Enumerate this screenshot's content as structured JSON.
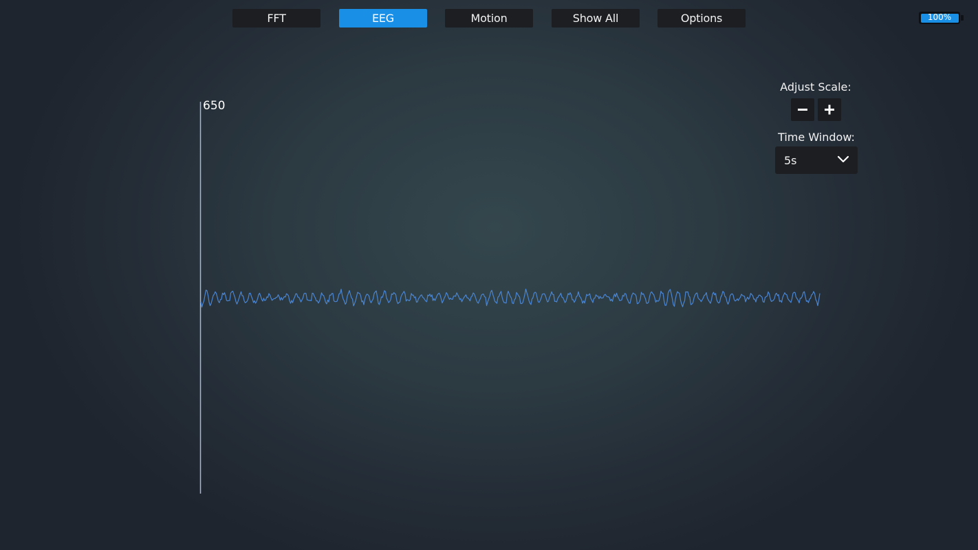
{
  "tabs": [
    {
      "label": "FFT",
      "active": false
    },
    {
      "label": "EEG",
      "active": true
    },
    {
      "label": "Motion",
      "active": false
    },
    {
      "label": "Show All",
      "active": false
    },
    {
      "label": "Options",
      "active": false
    }
  ],
  "battery": {
    "label": "100%",
    "level": 1.0
  },
  "controls": {
    "adjust_scale_label": "Adjust Scale:",
    "minus_icon": "minus-icon",
    "plus_icon": "plus-icon",
    "time_window_label": "Time Window:",
    "time_window_value": "5s",
    "dropdown_icon": "chevron-down-icon"
  },
  "plot": {
    "y_max_label": "650"
  },
  "colors": {
    "accent": "#1a8fe6",
    "signal": "#4a86d4",
    "axis": "#a7b8d4",
    "button_bg": "#1c1e22"
  }
}
